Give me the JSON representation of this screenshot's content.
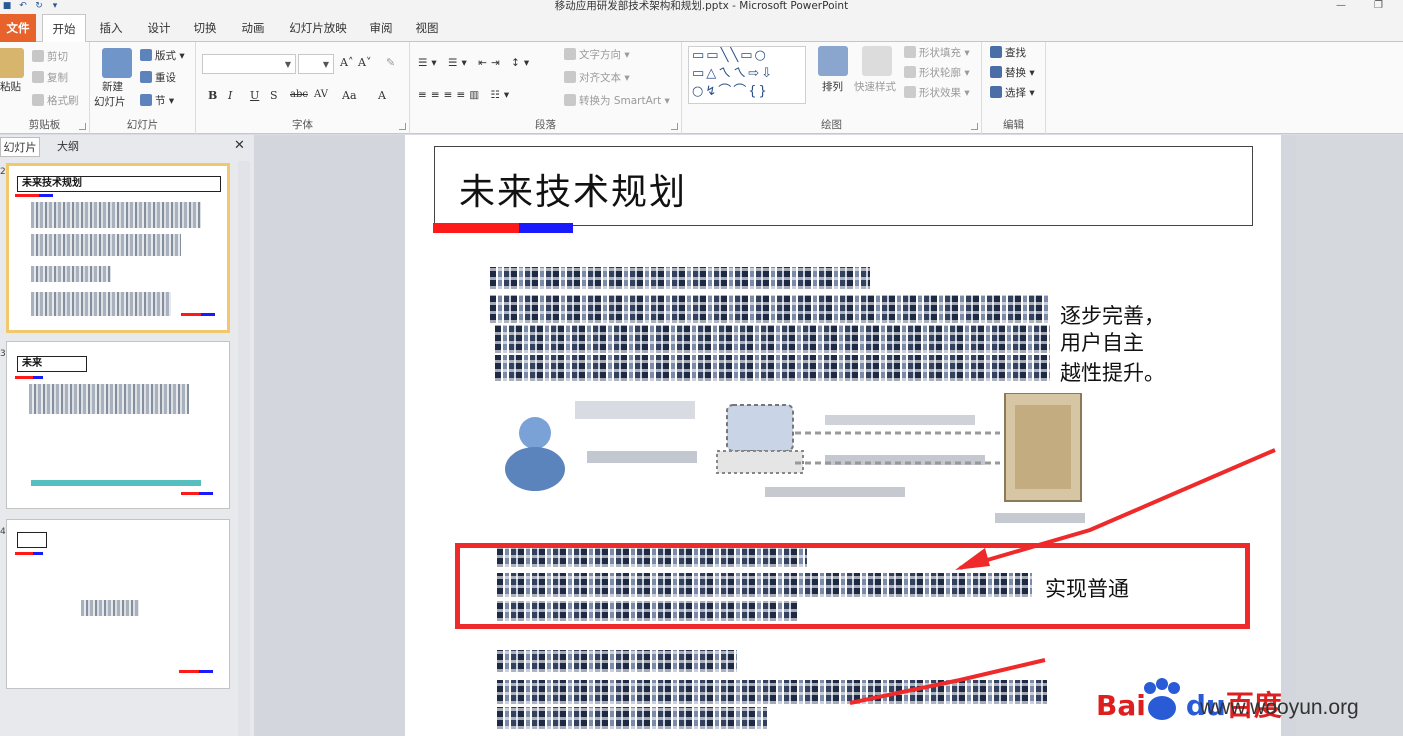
{
  "window": {
    "title": "移动应用研发部技术架构和规划.pptx  -  Microsoft PowerPoint"
  },
  "ribbon_tabs": [
    "文件",
    "开始",
    "插入",
    "设计",
    "切换",
    "动画",
    "幻灯片放映",
    "审阅",
    "视图"
  ],
  "ribbon": {
    "clipboard": {
      "label": "剪贴板",
      "paste": "粘贴",
      "cut": "剪切",
      "copy": "复制",
      "format_painter": "格式刷"
    },
    "slides": {
      "label": "幻灯片",
      "new_slide_1": "新建",
      "new_slide_2": "幻灯片",
      "layout": "版式",
      "reset": "重设",
      "section": "节"
    },
    "font": {
      "label": "字体",
      "bold": "B",
      "italic": "I",
      "underline": "U",
      "strike": "S",
      "abc": "abc",
      "av": "AV",
      "aa": "Aa",
      "font_color": "A"
    },
    "paragraph": {
      "label": "段落",
      "text_direction": "文字方向",
      "align_text": "对齐文本",
      "smartart": "转换为 SmartArt"
    },
    "drawing": {
      "label": "绘图",
      "arrange": "排列",
      "quick_styles": "快速样式",
      "shape_fill": "形状填充",
      "shape_outline": "形状轮廓",
      "shape_effects": "形状效果"
    },
    "editing": {
      "label": "编辑",
      "find": "查找",
      "replace": "替换",
      "select": "选择"
    }
  },
  "panel": {
    "tabs": [
      "幻灯片",
      "大纲"
    ],
    "thumbnails": [
      {
        "number": "2",
        "title": "未来技术规划"
      },
      {
        "number": "3",
        "title": "未来"
      },
      {
        "number": "4",
        "title": ""
      }
    ]
  },
  "slide": {
    "title": "未来技术规划",
    "visible_text": {
      "line1": "逐步完善，",
      "line2": "用户自主",
      "line3": "越性提升。",
      "line4": "实现普通"
    }
  },
  "watermark": {
    "baidu_bai": "Bai",
    "baidu_du": "du",
    "baidu_cn": "百度",
    "url": "www.wooyun.org"
  },
  "colors": {
    "file_tab": "#e8632b",
    "title_underline_red": "#ff1a1a",
    "title_underline_blue": "#1a1aff",
    "annotation_red": "#ee2a2a",
    "selected_thumb_border": "#f1c86d"
  }
}
